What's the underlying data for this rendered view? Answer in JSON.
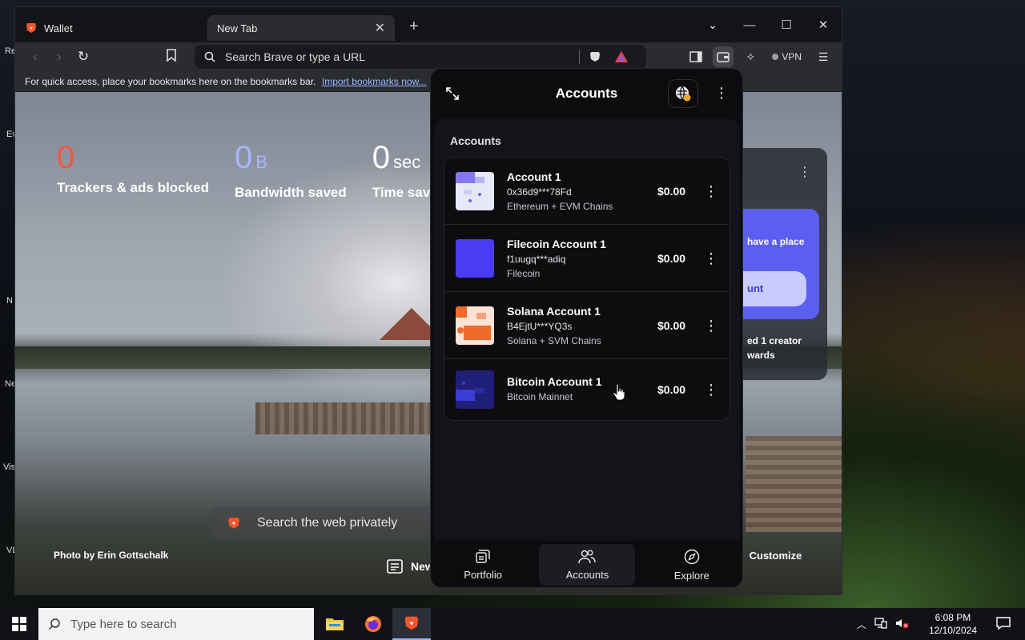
{
  "desktop": {
    "labels": [
      "Re",
      "Ev",
      "N",
      "Ne",
      "Vis",
      "VL"
    ]
  },
  "browser": {
    "tabs": [
      {
        "label": "Wallet"
      },
      {
        "label": "New Tab"
      }
    ],
    "urlbar_placeholder": "Search Brave or type a URL",
    "vpn_label": "VPN",
    "bookmarks_bar": {
      "message": "For quick access, place your bookmarks here on the bookmarks bar.",
      "link": "Import bookmarks now..."
    }
  },
  "ntp": {
    "stats": [
      {
        "value": "0",
        "unit": "",
        "label": "Trackers & ads blocked"
      },
      {
        "value": "0",
        "unit": "B",
        "label": "Bandwidth saved"
      },
      {
        "value": "0",
        "unit": "sec",
        "label": "Time sav"
      }
    ],
    "search_placeholder": "Search the web privately",
    "photo_credit": "Photo by Erin Gottschalk",
    "news_label": "New",
    "customize_label": "Customize",
    "rewards": {
      "purple_text": "have a place",
      "button_text": "unt",
      "footer_line1": "ed 1 creator",
      "footer_line2": "wards"
    }
  },
  "wallet": {
    "title": "Accounts",
    "section_label": "Accounts",
    "accounts": [
      {
        "name": "Account 1",
        "address": "0x36d9***78Fd",
        "chain": "Ethereum + EVM Chains",
        "balance": "$0.00"
      },
      {
        "name": "Filecoin Account 1",
        "address": "f1uugq***adiq",
        "chain": "Filecoin",
        "balance": "$0.00"
      },
      {
        "name": "Solana Account 1",
        "address": "B4EjtU***YQ3s",
        "chain": "Solana + SVM Chains",
        "balance": "$0.00"
      },
      {
        "name": "Bitcoin Account 1",
        "address": "",
        "chain": "Bitcoin Mainnet",
        "balance": "$0.00"
      }
    ],
    "nav": [
      {
        "label": "Portfolio"
      },
      {
        "label": "Accounts"
      },
      {
        "label": "Explore"
      }
    ],
    "colors": {
      "account1": "#6a5cf0",
      "filecoin": "#4a3cf0",
      "solana": "#f06a2c",
      "bitcoin": "#1f1f78"
    }
  },
  "taskbar": {
    "search_placeholder": "Type here to search",
    "time": "6:08 PM",
    "date": "12/10/2024"
  }
}
